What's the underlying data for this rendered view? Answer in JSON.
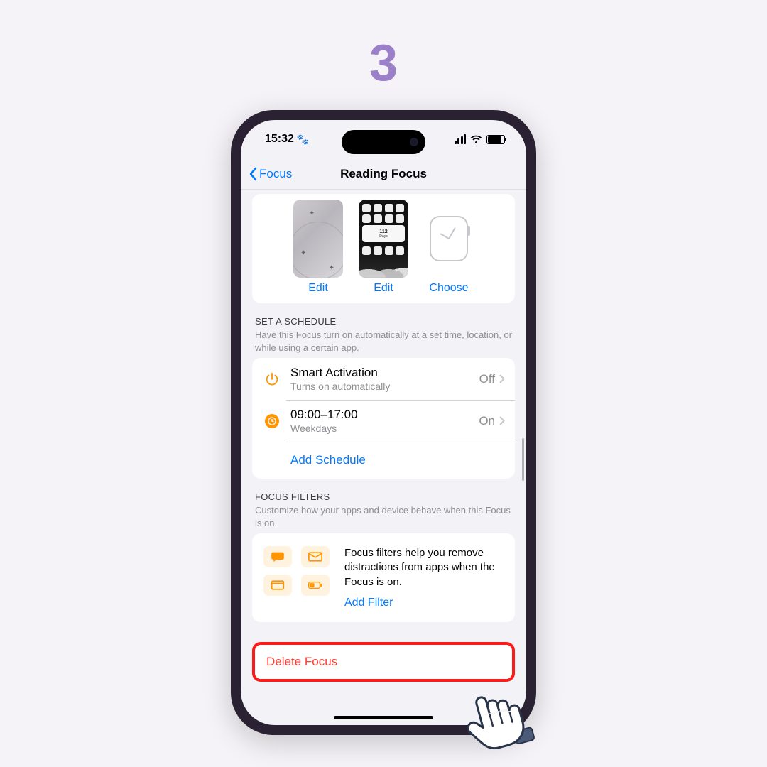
{
  "step_number": "3",
  "status": {
    "time": "15:32",
    "paw": "🐾"
  },
  "nav": {
    "back_label": "Focus",
    "title": "Reading Focus"
  },
  "screens": {
    "lock_action": "Edit",
    "home_action": "Edit",
    "watch_action": "Choose",
    "widget_num": "112",
    "widget_days": "Days"
  },
  "schedule": {
    "header": "SET A SCHEDULE",
    "desc": "Have this Focus turn on automatically at a set time, location, or while using a certain app.",
    "smart": {
      "title": "Smart Activation",
      "sub": "Turns on automatically",
      "value": "Off"
    },
    "time": {
      "title": "09:00–17:00",
      "sub": "Weekdays",
      "value": "On"
    },
    "add": "Add Schedule"
  },
  "filters": {
    "header": "FOCUS FILTERS",
    "desc": "Customize how your apps and device behave when this Focus is on.",
    "body": "Focus filters help you remove distractions from apps when the Focus is on.",
    "add": "Add Filter"
  },
  "delete": {
    "label": "Delete Focus"
  },
  "colors": {
    "accent": "#007aff",
    "orange": "#ff9500",
    "destructive": "#ff3b30",
    "step": "#9b7fc9"
  }
}
